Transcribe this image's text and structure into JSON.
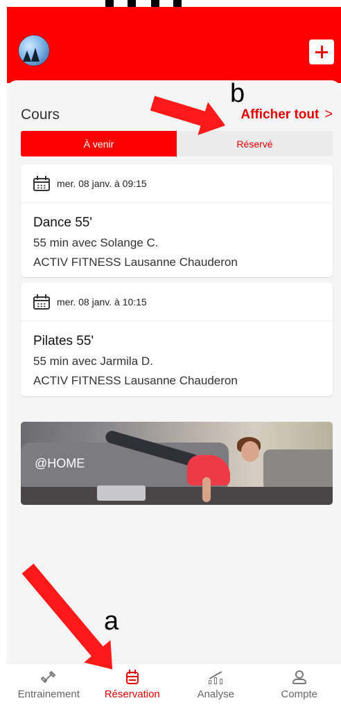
{
  "header": {
    "avatar_icon": "profile-avatar",
    "add_icon": "plus-icon",
    "accent_color": "#ff0000"
  },
  "courses": {
    "title": "Cours",
    "see_all_label": "Afficher tout",
    "see_all_chevron": ">",
    "tabs": [
      {
        "label": "À venir",
        "active": true
      },
      {
        "label": "Réservé",
        "active": false
      }
    ],
    "items": [
      {
        "datetime": "mer. 08 janv. à 09:15",
        "name": "Dance 55'",
        "duration_instructor": "55 min avec Solange C.",
        "location": "ACTIV FITNESS Lausanne Chauderon"
      },
      {
        "datetime": "mer. 08 janv. à 10:15",
        "name": "Pilates 55'",
        "duration_instructor": "55 min avec Jarmila D.",
        "location": "ACTIV FITNESS Lausanne Chauderon"
      }
    ]
  },
  "banner": {
    "label": "@HOME"
  },
  "bottom_nav": {
    "items": [
      {
        "label": "Entrainement",
        "icon": "dumbbell-icon",
        "active": false
      },
      {
        "label": "Réservation",
        "icon": "booking-icon",
        "active": true
      },
      {
        "label": "Analyse",
        "icon": "chart-icon",
        "active": false
      },
      {
        "label": "Compte",
        "icon": "account-icon",
        "active": false
      }
    ]
  },
  "annotations": {
    "marker_a": "a",
    "marker_b": "b"
  }
}
